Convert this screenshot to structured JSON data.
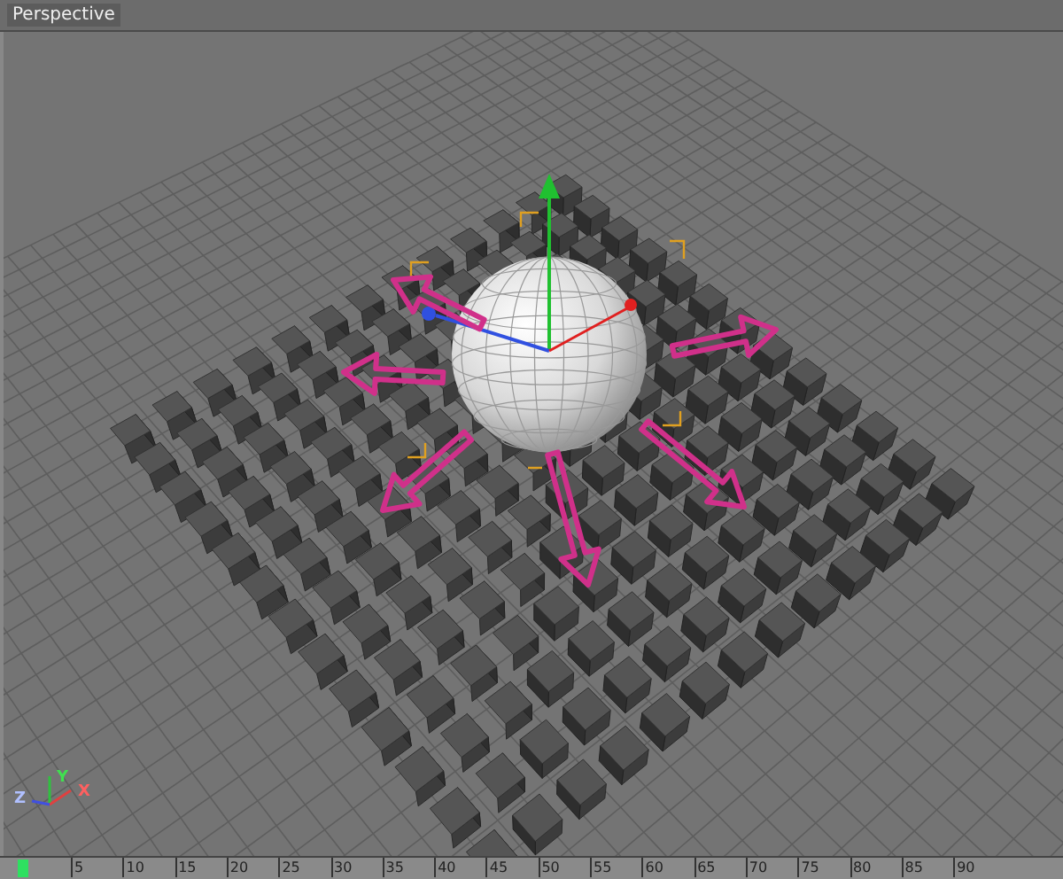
{
  "viewport": {
    "title": "Perspective"
  },
  "axis_gizmo": {
    "labels": [
      {
        "text": "X"
      },
      {
        "text": "Y"
      },
      {
        "text": "Z"
      }
    ]
  },
  "timeline": {
    "ticks": [
      "5",
      "10",
      "15",
      "20",
      "25",
      "30",
      "35",
      "40",
      "45",
      "50",
      "55",
      "60",
      "65",
      "70",
      "75",
      "80",
      "85",
      "90"
    ]
  }
}
